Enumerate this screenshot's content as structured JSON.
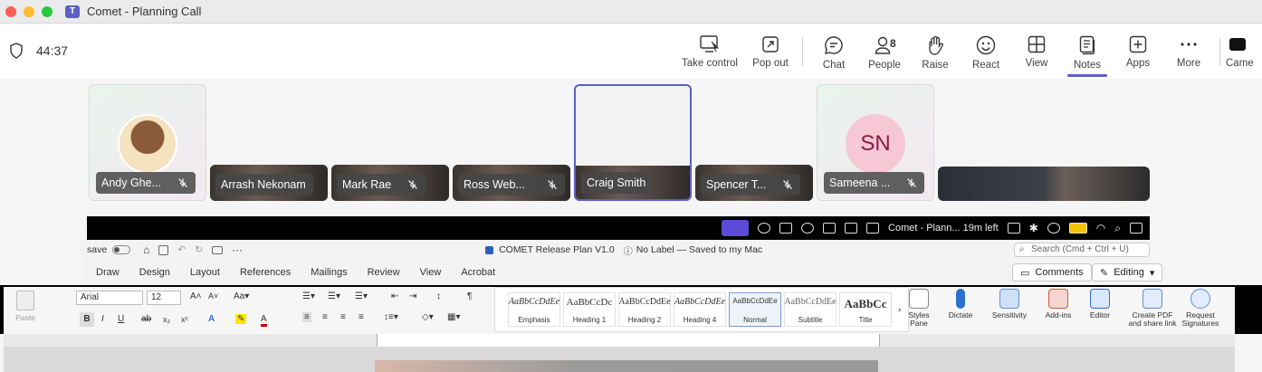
{
  "window": {
    "title": "Comet - Planning Call",
    "app_logo": "T"
  },
  "meeting": {
    "timer": "44:37",
    "toolbar": [
      {
        "label": "Take control",
        "icon": "take-control-icon"
      },
      {
        "label": "Pop out",
        "icon": "pop-out-icon"
      },
      {
        "label": "Chat",
        "icon": "chat-icon"
      },
      {
        "label": "People",
        "icon": "people-icon",
        "count": "8"
      },
      {
        "label": "Raise",
        "icon": "raise-hand-icon"
      },
      {
        "label": "React",
        "icon": "react-icon"
      },
      {
        "label": "View",
        "icon": "view-icon"
      },
      {
        "label": "Notes",
        "icon": "notes-icon",
        "active": true
      },
      {
        "label": "Apps",
        "icon": "apps-icon"
      },
      {
        "label": "More",
        "icon": "more-icon"
      },
      {
        "label": "Came",
        "icon": "camera-icon"
      }
    ],
    "accent_color": "#5b5fc7"
  },
  "participants": [
    {
      "name": "Andy Ghe...",
      "muted": true
    },
    {
      "name": "Arrash Nekonam",
      "muted": false
    },
    {
      "name": "Mark Rae",
      "muted": true
    },
    {
      "name": "Ross Web...",
      "muted": true
    },
    {
      "name": "Craig Smith",
      "muted": false,
      "selected": true
    },
    {
      "name": "Spencer T...",
      "muted": true
    },
    {
      "name": "Sameena ...",
      "muted": true,
      "initials": "SN"
    }
  ],
  "shared_screen": {
    "menubar_text": "Comet - Plann... 19m left",
    "word": {
      "autosave_label": "save",
      "doc_title": "COMET Release Plan V1.0",
      "label_status": "No Label — Saved to my Mac",
      "search_placeholder": "Search (Cmd + Ctrl + U)",
      "menus": [
        "Draw",
        "Design",
        "Layout",
        "References",
        "Mailings",
        "Review",
        "View",
        "Acrobat"
      ],
      "comments_label": "Comments",
      "editing_label": "Editing",
      "paste_label": "Paste",
      "font_name": "Arial",
      "font_size": "12",
      "styles": [
        {
          "sample": "AaBbCcDdEe",
          "name": "Emphasis"
        },
        {
          "sample": "AaBbCcDc",
          "name": "Heading 1"
        },
        {
          "sample": "AaBbCcDdEe",
          "name": "Heading 2"
        },
        {
          "sample": "AaBbCcDdEe",
          "name": "Heading 4"
        },
        {
          "sample": "AaBbCcDdEe",
          "name": "Normal",
          "selected": true
        },
        {
          "sample": "AaBbCcDdEe",
          "name": "Subtitle"
        },
        {
          "sample": "AaBbCc",
          "name": "Title"
        }
      ],
      "ribbon_buttons": [
        "Styles Pane",
        "Dictate",
        "Sensitivity",
        "Add-ins",
        "Editor",
        "Create PDF and share link",
        "Request Signatures"
      ]
    }
  }
}
